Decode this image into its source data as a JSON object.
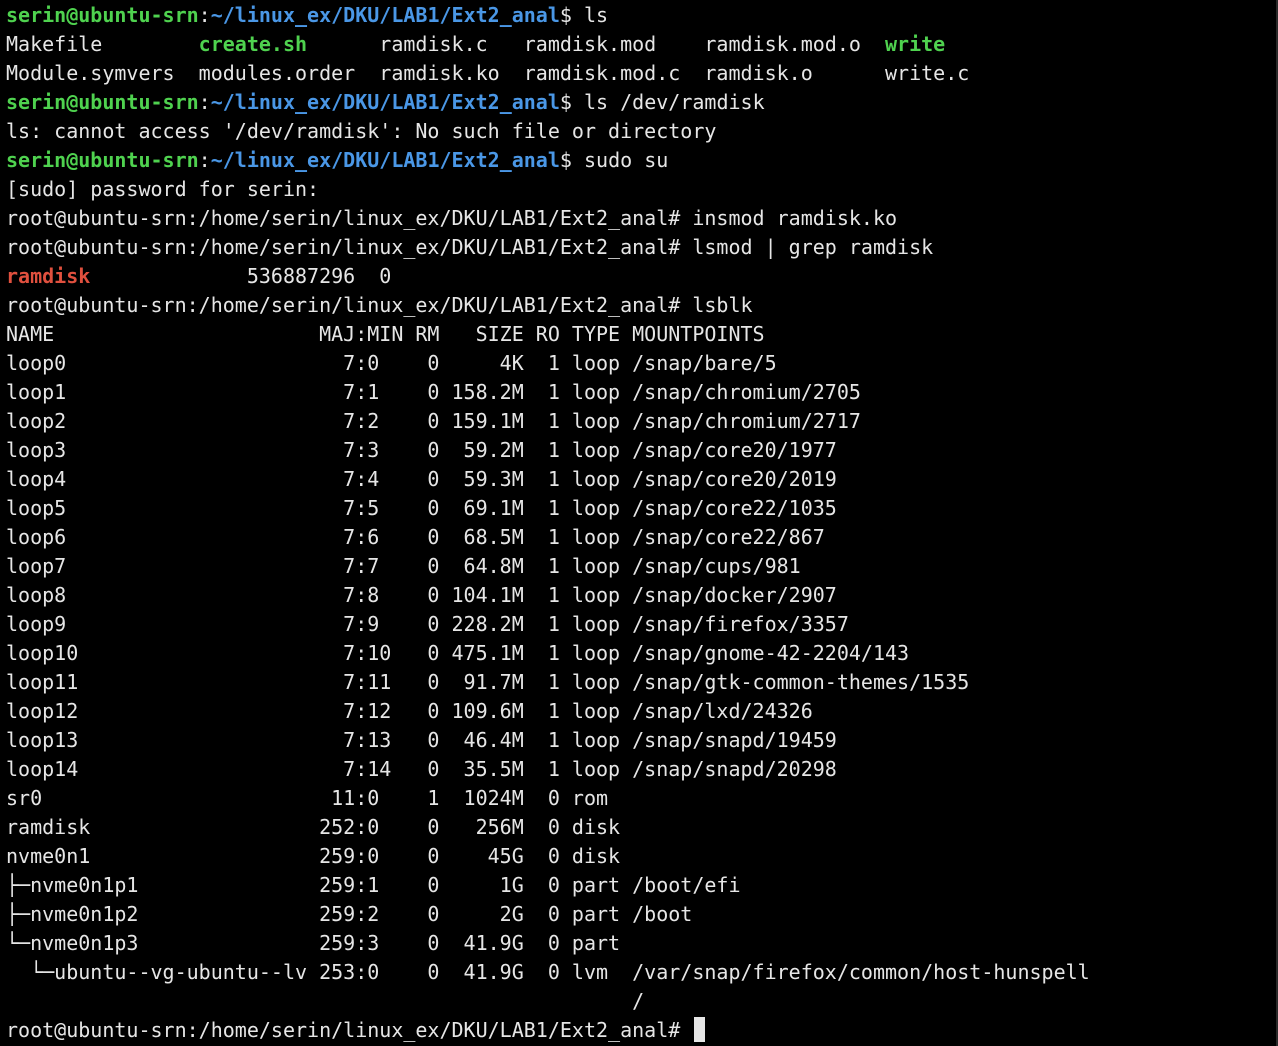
{
  "colors": {
    "background": "#000000",
    "text": "#e6e6e6",
    "prompt_user": "#4fd24f",
    "prompt_path": "#4a97e6",
    "executable": "#4fd24f",
    "highlight": "#e0503e"
  },
  "terminal": {
    "lines": [
      {
        "segments": [
          {
            "text": "serin@ubuntu-srn",
            "style": "user"
          },
          {
            "text": ":",
            "style": "plain"
          },
          {
            "text": "~/linux_ex/DKU/LAB1/Ext2_anal",
            "style": "path"
          },
          {
            "text": "$ ls",
            "style": "plain"
          }
        ]
      },
      {
        "segments": [
          {
            "text": "Makefile        ",
            "style": "plain"
          },
          {
            "text": "create.sh",
            "style": "green"
          },
          {
            "text": "      ramdisk.c   ramdisk.mod    ramdisk.mod.o  ",
            "style": "plain"
          },
          {
            "text": "write",
            "style": "green"
          }
        ]
      },
      {
        "segments": [
          {
            "text": "Module.symvers  modules.order  ramdisk.ko  ramdisk.mod.c  ramdisk.o      write.c",
            "style": "plain"
          }
        ]
      },
      {
        "segments": [
          {
            "text": "serin@ubuntu-srn",
            "style": "user"
          },
          {
            "text": ":",
            "style": "plain"
          },
          {
            "text": "~/linux_ex/DKU/LAB1/Ext2_anal",
            "style": "path"
          },
          {
            "text": "$ ls /dev/ramdisk",
            "style": "plain"
          }
        ]
      },
      {
        "segments": [
          {
            "text": "ls: cannot access '/dev/ramdisk': No such file or directory",
            "style": "plain"
          }
        ]
      },
      {
        "segments": [
          {
            "text": "serin@ubuntu-srn",
            "style": "user"
          },
          {
            "text": ":",
            "style": "plain"
          },
          {
            "text": "~/linux_ex/DKU/LAB1/Ext2_anal",
            "style": "path"
          },
          {
            "text": "$ sudo su",
            "style": "plain"
          }
        ]
      },
      {
        "segments": [
          {
            "text": "[sudo] password for serin:",
            "style": "plain"
          }
        ]
      },
      {
        "segments": [
          {
            "text": "root@ubuntu-srn:/home/serin/linux_ex/DKU/LAB1/Ext2_anal# insmod ramdisk.ko",
            "style": "plain"
          }
        ]
      },
      {
        "segments": [
          {
            "text": "root@ubuntu-srn:/home/serin/linux_ex/DKU/LAB1/Ext2_anal# lsmod | grep ramdisk",
            "style": "plain"
          }
        ]
      },
      {
        "segments": [
          {
            "text": "ramdisk",
            "style": "red"
          },
          {
            "text": "             536887296  0",
            "style": "plain"
          }
        ]
      },
      {
        "segments": [
          {
            "text": "root@ubuntu-srn:/home/serin/linux_ex/DKU/LAB1/Ext2_anal# lsblk",
            "style": "plain"
          }
        ]
      },
      {
        "segments": [
          {
            "text": "NAME                      MAJ:MIN RM   SIZE RO TYPE MOUNTPOINTS",
            "style": "plain"
          }
        ]
      },
      {
        "segments": [
          {
            "text": "loop0                       7:0    0     4K  1 loop /snap/bare/5",
            "style": "plain"
          }
        ]
      },
      {
        "segments": [
          {
            "text": "loop1                       7:1    0 158.2M  1 loop /snap/chromium/2705",
            "style": "plain"
          }
        ]
      },
      {
        "segments": [
          {
            "text": "loop2                       7:2    0 159.1M  1 loop /snap/chromium/2717",
            "style": "plain"
          }
        ]
      },
      {
        "segments": [
          {
            "text": "loop3                       7:3    0  59.2M  1 loop /snap/core20/1977",
            "style": "plain"
          }
        ]
      },
      {
        "segments": [
          {
            "text": "loop4                       7:4    0  59.3M  1 loop /snap/core20/2019",
            "style": "plain"
          }
        ]
      },
      {
        "segments": [
          {
            "text": "loop5                       7:5    0  69.1M  1 loop /snap/core22/1035",
            "style": "plain"
          }
        ]
      },
      {
        "segments": [
          {
            "text": "loop6                       7:6    0  68.5M  1 loop /snap/core22/867",
            "style": "plain"
          }
        ]
      },
      {
        "segments": [
          {
            "text": "loop7                       7:7    0  64.8M  1 loop /snap/cups/981",
            "style": "plain"
          }
        ]
      },
      {
        "segments": [
          {
            "text": "loop8                       7:8    0 104.1M  1 loop /snap/docker/2907",
            "style": "plain"
          }
        ]
      },
      {
        "segments": [
          {
            "text": "loop9                       7:9    0 228.2M  1 loop /snap/firefox/3357",
            "style": "plain"
          }
        ]
      },
      {
        "segments": [
          {
            "text": "loop10                      7:10   0 475.1M  1 loop /snap/gnome-42-2204/143",
            "style": "plain"
          }
        ]
      },
      {
        "segments": [
          {
            "text": "loop11                      7:11   0  91.7M  1 loop /snap/gtk-common-themes/1535",
            "style": "plain"
          }
        ]
      },
      {
        "segments": [
          {
            "text": "loop12                      7:12   0 109.6M  1 loop /snap/lxd/24326",
            "style": "plain"
          }
        ]
      },
      {
        "segments": [
          {
            "text": "loop13                      7:13   0  46.4M  1 loop /snap/snapd/19459",
            "style": "plain"
          }
        ]
      },
      {
        "segments": [
          {
            "text": "loop14                      7:14   0  35.5M  1 loop /snap/snapd/20298",
            "style": "plain"
          }
        ]
      },
      {
        "segments": [
          {
            "text": "sr0                        11:0    1  1024M  0 rom",
            "style": "plain"
          }
        ]
      },
      {
        "segments": [
          {
            "text": "ramdisk                   252:0    0   256M  0 disk",
            "style": "plain"
          }
        ]
      },
      {
        "segments": [
          {
            "text": "nvme0n1                   259:0    0    45G  0 disk",
            "style": "plain"
          }
        ]
      },
      {
        "segments": [
          {
            "text": "├─nvme0n1p1               259:1    0     1G  0 part /boot/efi",
            "style": "plain"
          }
        ]
      },
      {
        "segments": [
          {
            "text": "├─nvme0n1p2               259:2    0     2G  0 part /boot",
            "style": "plain"
          }
        ]
      },
      {
        "segments": [
          {
            "text": "└─nvme0n1p3               259:3    0  41.9G  0 part",
            "style": "plain"
          }
        ]
      },
      {
        "segments": [
          {
            "text": "  └─ubuntu--vg-ubuntu--lv 253:0    0  41.9G  0 lvm  /var/snap/firefox/common/host-hunspell",
            "style": "plain"
          }
        ]
      },
      {
        "segments": [
          {
            "text": "                                                    /",
            "style": "plain"
          }
        ]
      },
      {
        "segments": [
          {
            "text": "root@ubuntu-srn:/home/serin/linux_ex/DKU/LAB1/Ext2_anal# ",
            "style": "plain"
          }
        ],
        "cursor": true
      }
    ]
  }
}
